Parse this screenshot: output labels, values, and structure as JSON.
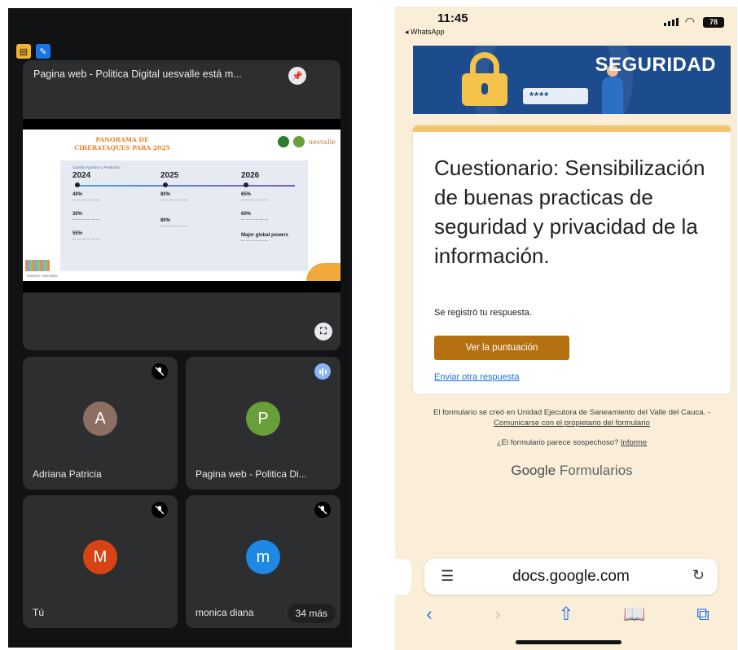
{
  "meet": {
    "presentation_title": "Pagina web - Politica Digital uesvalle está m...",
    "slide": {
      "title": "PANORAMA DE CIBERATAQUES PARA 2025",
      "subtitle": "Cambio Agresivo y Predictivo",
      "years": [
        "2024",
        "2025",
        "2026"
      ],
      "stats_2024": [
        "40%",
        "30%",
        "55%"
      ],
      "stats_2025": [
        "80%",
        "80%"
      ],
      "stats_2026": [
        "65%",
        "60%",
        "Major global powers"
      ],
      "footer": "FUENTE: GARTNER",
      "logo_text": "uesvalle"
    },
    "tiles": [
      {
        "name": "Adriana Patricia",
        "initial": "A",
        "color": "#8d6e63"
      },
      {
        "name": "Pagina web - Politica Di...",
        "initial": "P",
        "color": "#689f38"
      },
      {
        "name": "Tú",
        "initial": "M",
        "color": "#d84315"
      },
      {
        "name": "monica diana",
        "initial": "m",
        "color": "#1e88e5"
      }
    ],
    "more_badge": "34 más"
  },
  "phone": {
    "time": "11:45",
    "back_app": "◂ WhatsApp",
    "battery": "78",
    "banner_title": "SEGURIDAD",
    "banner_password": "****",
    "form_title": "Cuestionario: Sensibilización de buenas practicas de seguridad y privacidad de la información.",
    "confirmation": "Se registró tu respuesta.",
    "score_button": "Ver la puntuación",
    "another_link": "Enviar otra respuesta",
    "footer_text": "El formulario se creó en Unidad Ejecutora de Saneamiento del Valle del Cauca. -",
    "footer_link": "Comunicarse con el propietario del formulario",
    "suspicious_text": "¿El formulario parece sospechoso?",
    "report_link": "Informe",
    "brand_google": "Google",
    "brand_forms": "Formularios",
    "url": "docs.google.com"
  }
}
